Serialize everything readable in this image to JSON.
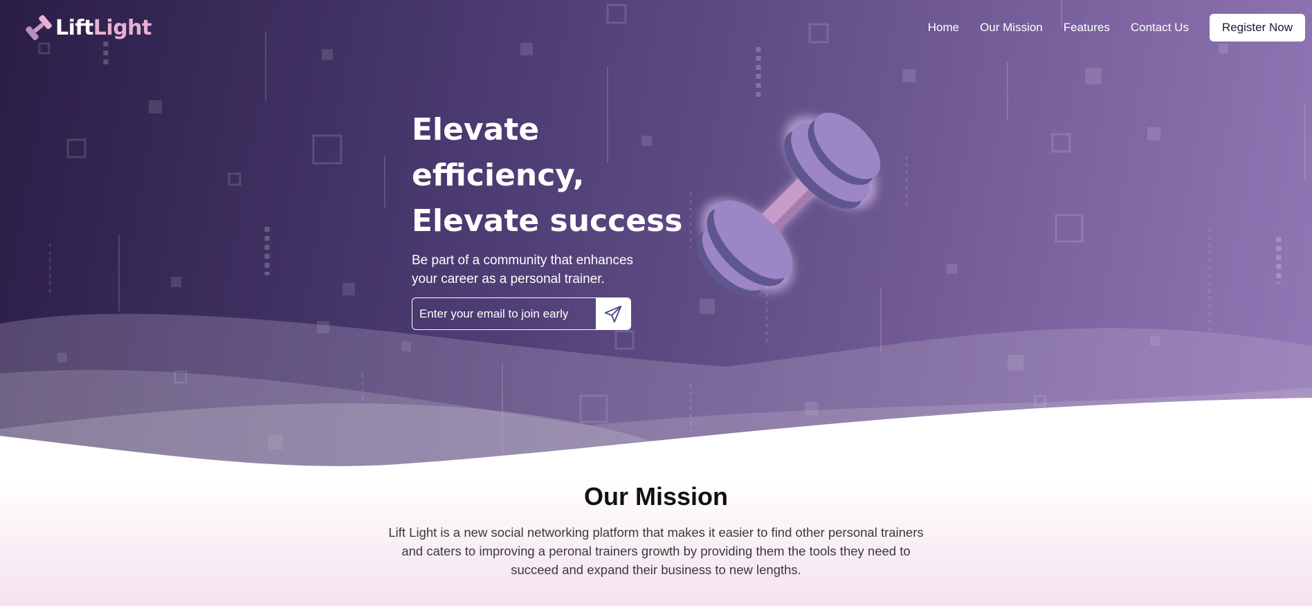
{
  "brand": {
    "name_part1": "Lift",
    "name_part2": "Light",
    "icon": "dumbbell-icon",
    "colors": {
      "accent": "#e7b1d2",
      "hero_dark": "#2a1d45",
      "hero_light": "#9378b6",
      "dumbbell_weight": "#9d86c6",
      "dumbbell_handle": "#c89bc9"
    }
  },
  "nav": {
    "links": [
      "Home",
      "Our Mission",
      "Features",
      "Contact Us"
    ],
    "cta_label": "Register Now"
  },
  "hero": {
    "headline_lines": [
      "Elevate",
      "efficiency,",
      "Elevate success"
    ],
    "subtitle": "Be part of a community that enhances your career as a personal trainer.",
    "email_placeholder": "Enter your email to join early",
    "submit_icon": "send-icon",
    "illustration": "dumbbell-icon"
  },
  "mission": {
    "title": "Our Mission",
    "body": "Lift Light is a new social networking platform that makes it easier to find other personal trainers and caters to improving a peronal trainers growth by providing them the tools they need to succeed and expand their business to new lengths."
  }
}
